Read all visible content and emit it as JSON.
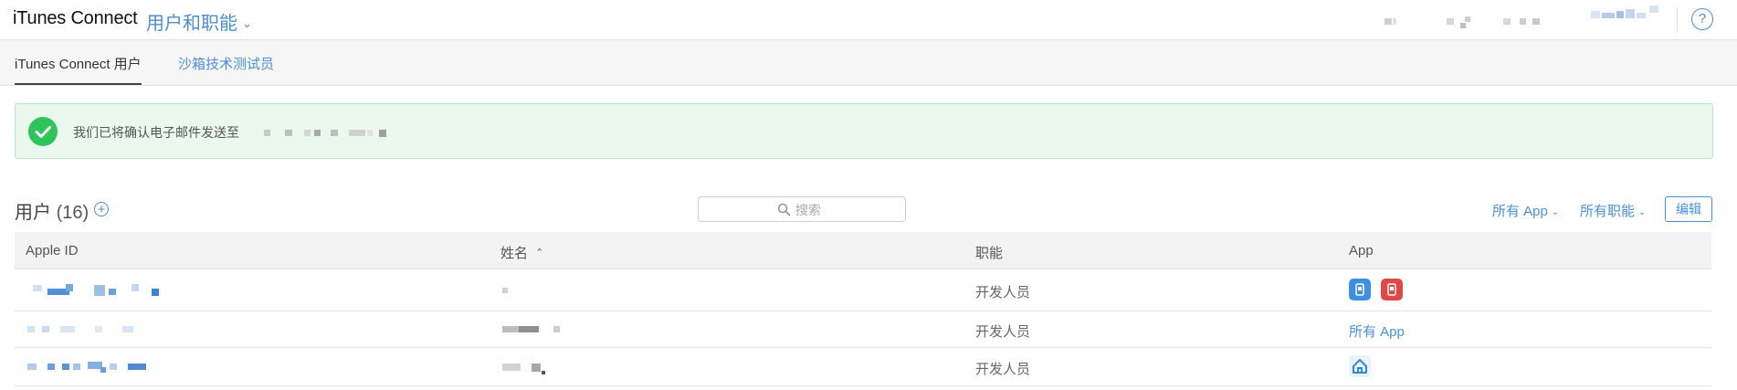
{
  "header": {
    "brand": "iTunes Connect",
    "section": "用户和职能",
    "help_label": "?"
  },
  "tabs": [
    {
      "label": "iTunes Connect 用户",
      "active": true
    },
    {
      "label": "沙箱技术测试员",
      "active": false
    }
  ],
  "banner": {
    "message": "我们已将确认电子邮件发送至"
  },
  "users": {
    "title": "用户",
    "count": "(16)",
    "add_label": "+",
    "search_placeholder": "搜索",
    "filters": [
      "所有 App",
      "所有职能"
    ],
    "edit_label": "编辑"
  },
  "table": {
    "columns": [
      "Apple ID",
      "姓名",
      "职能",
      "App"
    ],
    "rows": [
      {
        "role": "开发人员",
        "app": ""
      },
      {
        "role": "开发人员",
        "app": "所有 App"
      },
      {
        "role": "开发人员",
        "app": ""
      }
    ]
  },
  "colors": {
    "accent": "#4a90d9",
    "success": "#2ec45a",
    "banner_bg": "#eaf8ed"
  }
}
